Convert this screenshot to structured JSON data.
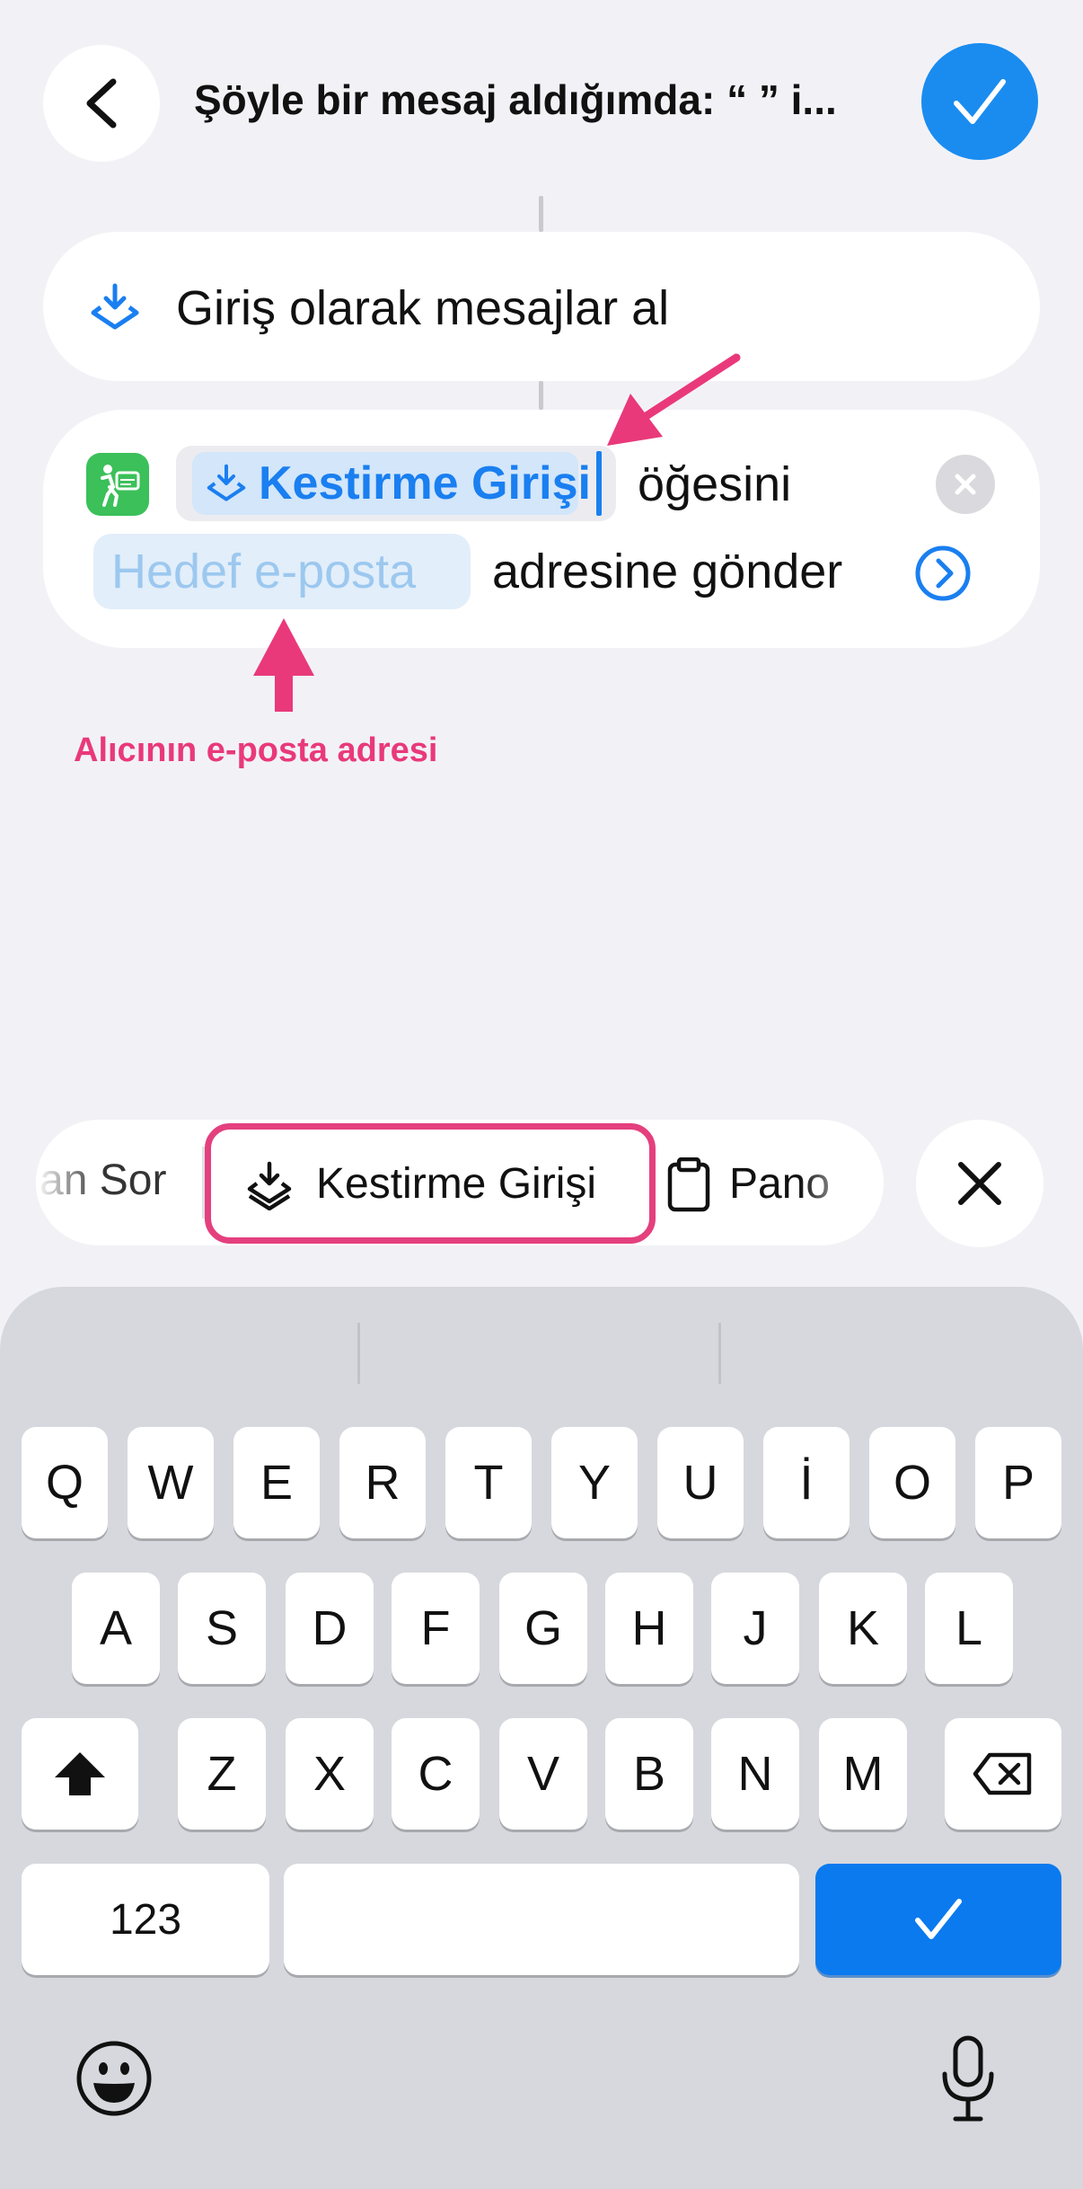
{
  "header": {
    "title": "Şöyle bir mesaj aldığımda: “ ” i..."
  },
  "actions": {
    "receive": {
      "label": "Giriş olarak mesajlar al"
    },
    "send": {
      "variable_label": "Kestirme Girişi",
      "text_after_variable": "öğesini",
      "email_placeholder": "Hedef e-posta",
      "text_after_email": "adresine gönder"
    }
  },
  "annotation": {
    "label": "Alıcının e-posta adresi",
    "color": "#e9397b"
  },
  "suggestions": {
    "previous_label": "an Sor",
    "selected_label": "Kestirme Girişi",
    "next_label": "Pano"
  },
  "keyboard": {
    "row1": [
      "Q",
      "W",
      "E",
      "R",
      "T",
      "Y",
      "U",
      "İ",
      "O",
      "P"
    ],
    "row2": [
      "A",
      "S",
      "D",
      "F",
      "G",
      "H",
      "J",
      "K",
      "L"
    ],
    "row3": [
      "Z",
      "X",
      "C",
      "V",
      "B",
      "N",
      "M"
    ],
    "numbers_label": "123"
  },
  "colors": {
    "accent": "#1a8cf0",
    "variable_text": "#1a7ff0",
    "highlight": "#e4407e",
    "app_icon": "#3cc05a"
  },
  "icons": {
    "back": "chevron-left-icon",
    "done": "checkmark-icon",
    "shortcut_input": "shortcut-input-icon",
    "app": "sms-app-icon",
    "clear": "close-icon",
    "info": "chevron-right-circle-icon",
    "clipboard": "clipboard-icon",
    "shift": "shift-icon",
    "delete": "delete-icon",
    "emoji": "emoji-icon",
    "mic": "microphone-icon"
  }
}
